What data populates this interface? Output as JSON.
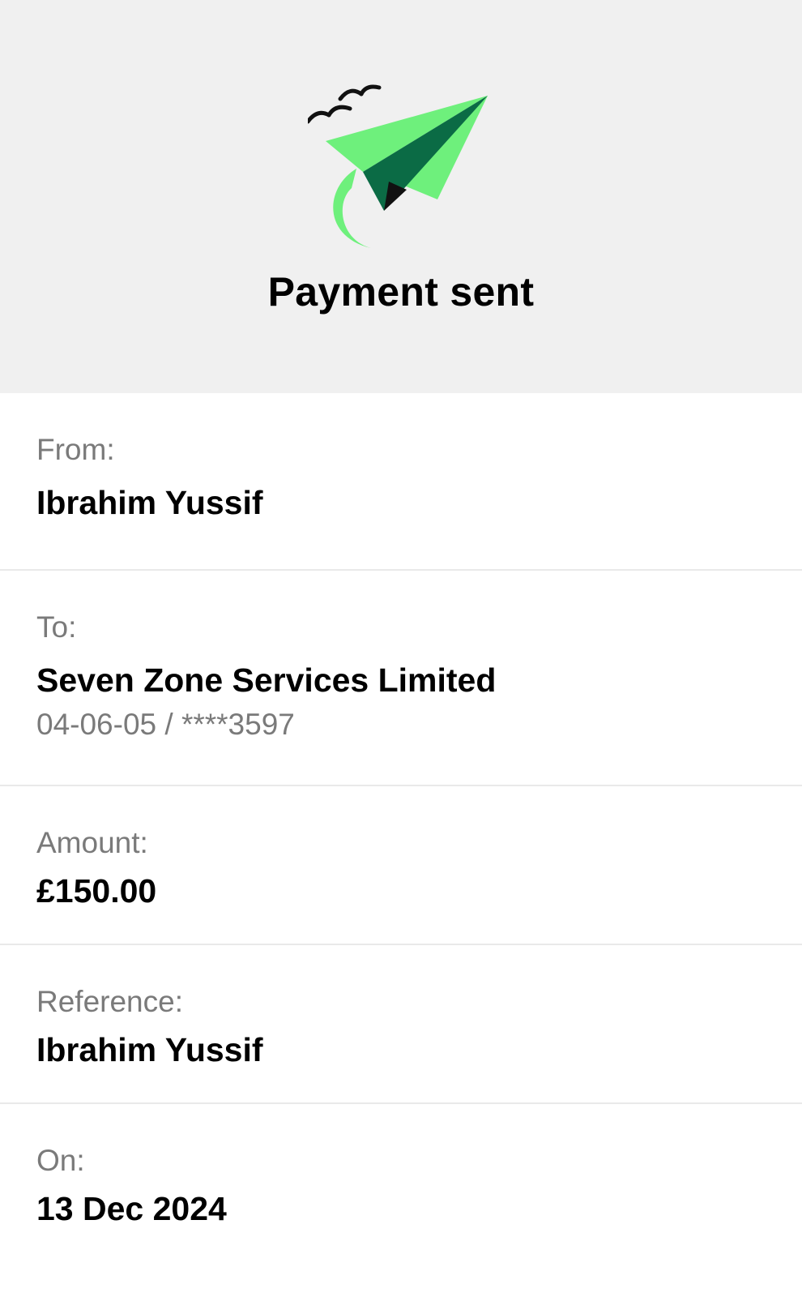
{
  "header": {
    "title": "Payment sent",
    "illustration_icon": "paper-plane-icon",
    "colors": {
      "background": "#f0f0f0",
      "plane_light": "#6ef07c",
      "plane_dark": "#0b6b45"
    }
  },
  "details": {
    "from": {
      "label": "From:",
      "value": "Ibrahim Yussif"
    },
    "to": {
      "label": "To:",
      "value": "Seven Zone Services Limited",
      "account": "04-06-05 / ****3597"
    },
    "amount": {
      "label": "Amount:",
      "value": "£150.00"
    },
    "reference": {
      "label": "Reference:",
      "value": "Ibrahim Yussif"
    },
    "on": {
      "label": "On:",
      "value": "13 Dec 2024"
    }
  }
}
